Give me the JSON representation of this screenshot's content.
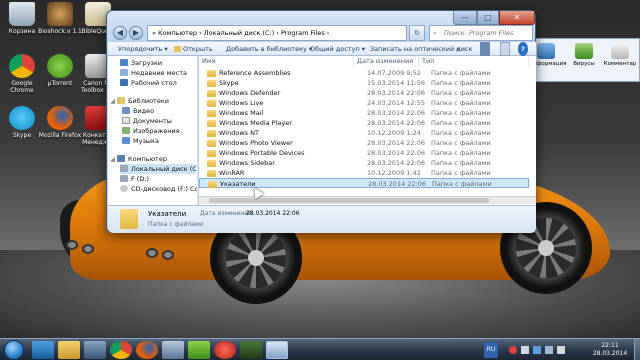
{
  "desktop": {
    "icons": [
      {
        "label": "Корзина",
        "icon": "recycle-bin-icon"
      },
      {
        "label": "Bioshock.v 1.1",
        "icon": "bioshock-icon"
      },
      {
        "label": "BibleQuote",
        "icon": "biblequote-icon"
      },
      {
        "label": "Google Chrome",
        "icon": "chrome-icon"
      },
      {
        "label": "µTorrent",
        "icon": "utorrent-icon"
      },
      {
        "label": "Canon MF Toolbox 4.9",
        "icon": "canon-icon"
      },
      {
        "label": "Skype",
        "icon": "skype-icon"
      },
      {
        "label": "Mozilla Firefox",
        "icon": "firefox-icon"
      },
      {
        "label": "Конкатер Менедж...",
        "icon": "manager-icon"
      }
    ]
  },
  "window": {
    "address": "« Компьютер › Локальный диск (C:) › Program Files ›",
    "search_placeholder": "Поиск: Program Files",
    "controls": {
      "minimize": "—",
      "maximize": "□",
      "close": "✕"
    },
    "toolbar": {
      "organize": "Упорядочить ▾",
      "open": "Открыть",
      "add_to_library": "Добавить в библиотеку ▾",
      "share": "Общий доступ ▾",
      "burn": "Записать на оптический диск",
      "more": "»"
    },
    "nav": {
      "favorites": [
        {
          "label": "Загрузки",
          "icon": "downloads-icon"
        },
        {
          "label": "Недавние места",
          "icon": "recent-places-icon"
        },
        {
          "label": "Рабочий стол",
          "icon": "desktop-icon"
        }
      ],
      "libraries_header": "Библиотеки",
      "libraries": [
        {
          "label": "Видео",
          "icon": "video-icon"
        },
        {
          "label": "Документы",
          "icon": "documents-icon"
        },
        {
          "label": "Изображения",
          "icon": "pictures-icon"
        },
        {
          "label": "Музыка",
          "icon": "music-icon"
        }
      ],
      "computer_header": "Компьютер",
      "drives": [
        {
          "label": "Локальный диск (C:)",
          "icon": "hard-drive-icon"
        },
        {
          "label": "F (D:)",
          "icon": "hard-drive-icon"
        },
        {
          "label": "CD-дисковод (F:) Conv",
          "icon": "cd-drive-icon"
        }
      ]
    },
    "columns": {
      "name": "Имя",
      "date": "Дата изменения",
      "type": "Тип"
    },
    "files": [
      {
        "name": "Reference Assemblies",
        "date": "14.07.2009 9:52",
        "type": "Папка с файлами"
      },
      {
        "name": "Skype",
        "date": "15.03.2014 11:56",
        "type": "Папка с файлами"
      },
      {
        "name": "Windows Defender",
        "date": "28.03.2014 22:06",
        "type": "Папка с файлами"
      },
      {
        "name": "Windows Live",
        "date": "24.03.2014 12:55",
        "type": "Папка с файлами"
      },
      {
        "name": "Windows Mail",
        "date": "28.03.2014 22:06",
        "type": "Папка с файлами"
      },
      {
        "name": "Windows Media Player",
        "date": "28.03.2014 22:06",
        "type": "Папка с файлами"
      },
      {
        "name": "Windows NT",
        "date": "10.12.2009 1:24",
        "type": "Папка с файлами"
      },
      {
        "name": "Windows Photo Viewer",
        "date": "28.03.2014 22:06",
        "type": "Папка с файлами"
      },
      {
        "name": "Windows Portable Devices",
        "date": "28.03.2014 22:06",
        "type": "Папка с файлами"
      },
      {
        "name": "Windows Sidebar",
        "date": "28.03.2014 22:06",
        "type": "Папка с файлами"
      },
      {
        "name": "WinRAR",
        "date": "10.12.2009 1:42",
        "type": "Папка с файлами"
      },
      {
        "name": "Указатели",
        "date": "28.03.2014 22:06",
        "type": "Папка с файлами"
      }
    ],
    "details": {
      "name": "Указатели",
      "date_label": "Дата изменения:",
      "date_value": "28.03.2014 22:06",
      "type": "Папка с файлами"
    }
  },
  "right_app": {
    "buttons": [
      {
        "label": "Информация",
        "icon": "info-icon"
      },
      {
        "label": "Вирусы",
        "icon": "virus-icon"
      },
      {
        "label": "Комментар",
        "icon": "comment-icon"
      }
    ]
  },
  "taskbar": {
    "lang": "RU",
    "time": "22:11",
    "date": "28.03.2014"
  },
  "colors": {
    "accent": "#2c7fc8",
    "selection": "#cde8ff",
    "car": "#e07b0a"
  }
}
